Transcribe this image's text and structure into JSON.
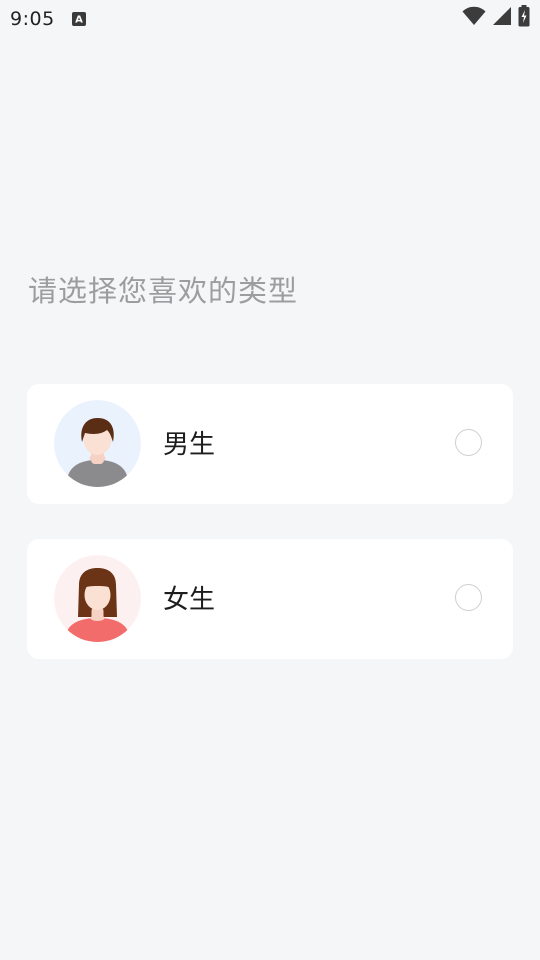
{
  "status_bar": {
    "time": "9:05",
    "notification_icon": "font-a-icon",
    "icons": [
      "wifi-icon",
      "cell-signal-icon",
      "battery-charging-icon"
    ]
  },
  "prompt": "请选择您喜欢的类型",
  "options": [
    {
      "label": "男生",
      "avatar": "male-avatar-icon",
      "avatar_bg": "#eaf2fd",
      "selected": false
    },
    {
      "label": "女生",
      "avatar": "female-avatar-icon",
      "avatar_bg": "#fdf0f0",
      "selected": false
    }
  ],
  "colors": {
    "background": "#f5f6f8",
    "card": "#ffffff",
    "prompt_text": "#9d9d9f",
    "label_text": "#1d1d1f",
    "radio_border": "#cfcfd2"
  }
}
